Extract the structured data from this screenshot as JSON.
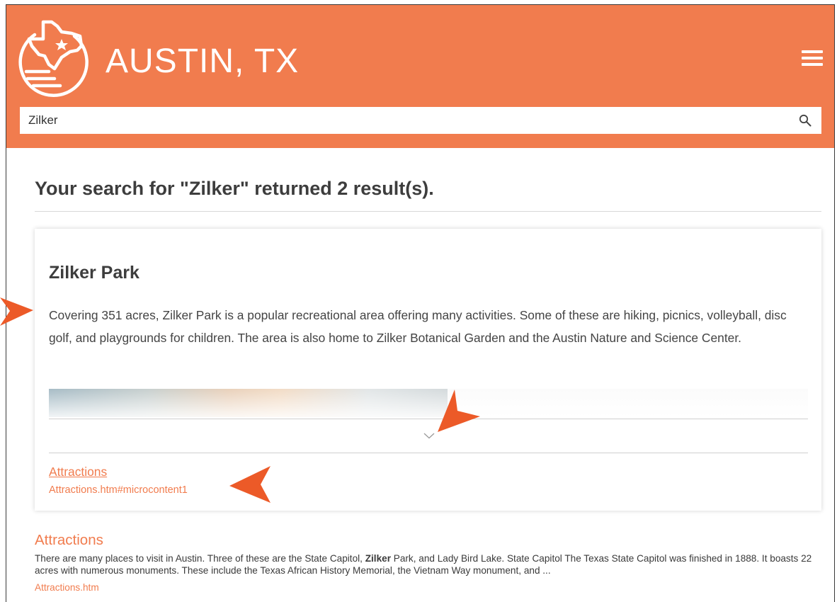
{
  "header": {
    "site_title": "AUSTIN, TX",
    "brand_color": "#f17c4e",
    "logo_icon": "texas-outline-star-logo",
    "menu_icon": "hamburger-menu-icon"
  },
  "search": {
    "value": "Zilker",
    "icon": "search-icon"
  },
  "results": {
    "heading": "Your search for \"Zilker\" returned 2 result(s).",
    "micro_card": {
      "title": "Zilker Park",
      "body": "Covering 351 acres, Zilker Park is a popular recreational area offering many activities. Some of these are hiking, picnics, volleyball, disc golf, and playgrounds for children. The area is also home to Zilker Botanical Garden and the Austin Nature and Science Center.",
      "expand_icon": "chevron-down-icon",
      "link_label": "Attractions",
      "link_url": "Attractions.htm#microcontent1"
    },
    "second": {
      "title": "Attractions",
      "snippet_before": "There are many places to visit in Austin. Three of these are the State Capitol, ",
      "snippet_bold": "Zilker",
      "snippet_after": " Park, and Lady Bird Lake. State Capitol The Texas State Capitol was finished in 1888. It boasts 22 acres with numerous monuments. These include the Texas African History Memorial, the Vietnam Way monument, and ...",
      "url": "Attractions.htm"
    }
  },
  "callouts": {
    "color": "#e94e1b",
    "icon": "arrow-pointer-icon"
  }
}
